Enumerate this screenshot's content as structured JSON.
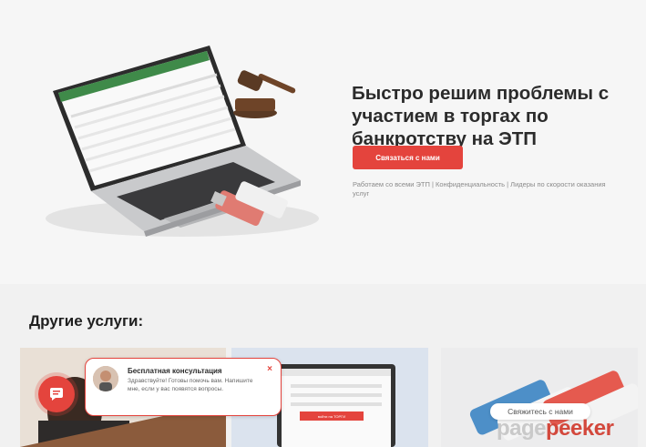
{
  "hero": {
    "title": "Быстро решим проблемы с участием в торгах по банкротству на ЭТП",
    "cta_label": "Связаться с нами",
    "subtitle": "Работаем со всеми ЭТП | Конфиденциальность | Лидеры по скорости оказания услуг"
  },
  "services": {
    "title": "Другие услуги:",
    "card2_button": "войти на ТОРГИ"
  },
  "chat": {
    "title": "Бесплатная консультация",
    "text": "Здравствуйте! Готовы помочь вам. Напишите мне, если у вас появятся вопросы.",
    "close": "×"
  },
  "contact_label": "Свяжитесь с нами",
  "watermark": {
    "part1": "page",
    "part2": "peeker"
  },
  "icons": [
    "gavel-icon",
    "laptop-icon",
    "usb-token-icon",
    "chat-icon",
    "avatar-icon"
  ],
  "colors": {
    "accent": "#e4443d",
    "background": "#f6f6f6"
  }
}
